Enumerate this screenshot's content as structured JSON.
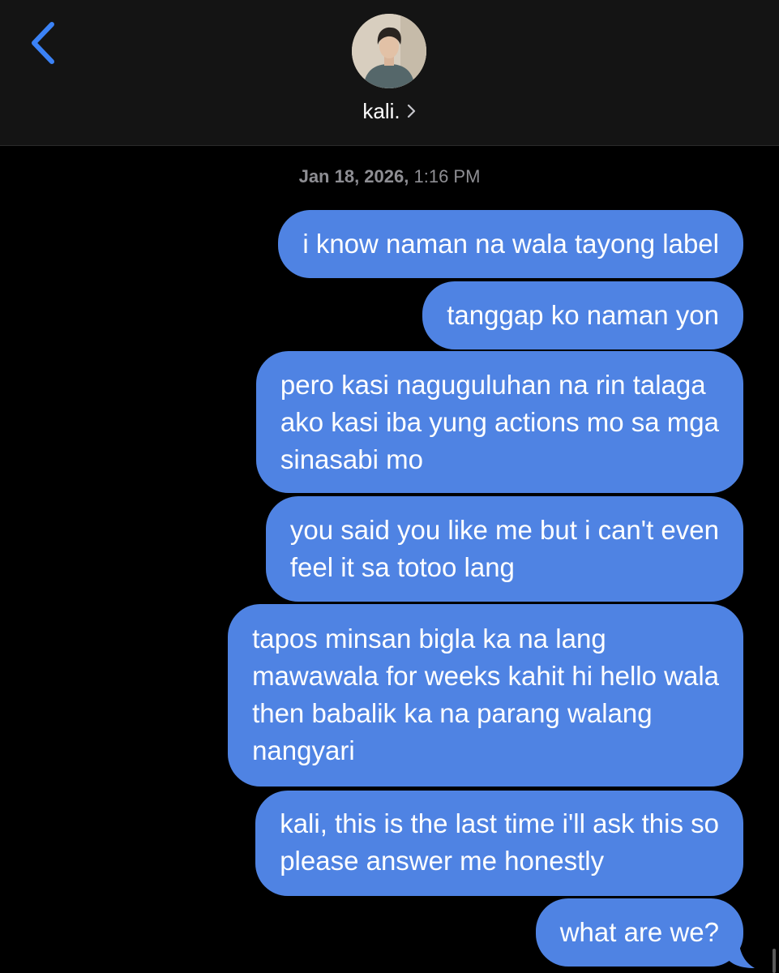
{
  "header": {
    "contact_name": "kali.",
    "chevron": "›"
  },
  "thread": {
    "timestamp_date": "Jan 18, 2026,",
    "timestamp_time": "1:16 PM",
    "messages": [
      {
        "lines": [
          "i know naman na wala tayong label"
        ]
      },
      {
        "lines": [
          "tanggap ko naman yon"
        ]
      },
      {
        "lines": [
          "pero kasi naguguluhan na rin talaga",
          "ako kasi iba yung actions mo sa mga",
          "sinasabi mo"
        ]
      },
      {
        "lines": [
          "you said you like me but i can't even",
          "feel it sa totoo lang"
        ]
      },
      {
        "lines": [
          "tapos minsan bigla ka na lang",
          "mawawala for weeks kahit hi hello wala",
          "then babalik ka na parang walang",
          "nangyari"
        ]
      },
      {
        "lines": [
          "kali, this is the last time i'll ask this so",
          "please answer me honestly"
        ]
      },
      {
        "lines": [
          "what are we?"
        ]
      }
    ]
  },
  "colors": {
    "bubble": "#4f83e3",
    "accent": "#3b82f6",
    "header_bg": "#141414",
    "timestamp": "#8e8e93"
  },
  "icons": [
    "back-chevron-icon",
    "avatar",
    "chevron-right-icon"
  ]
}
